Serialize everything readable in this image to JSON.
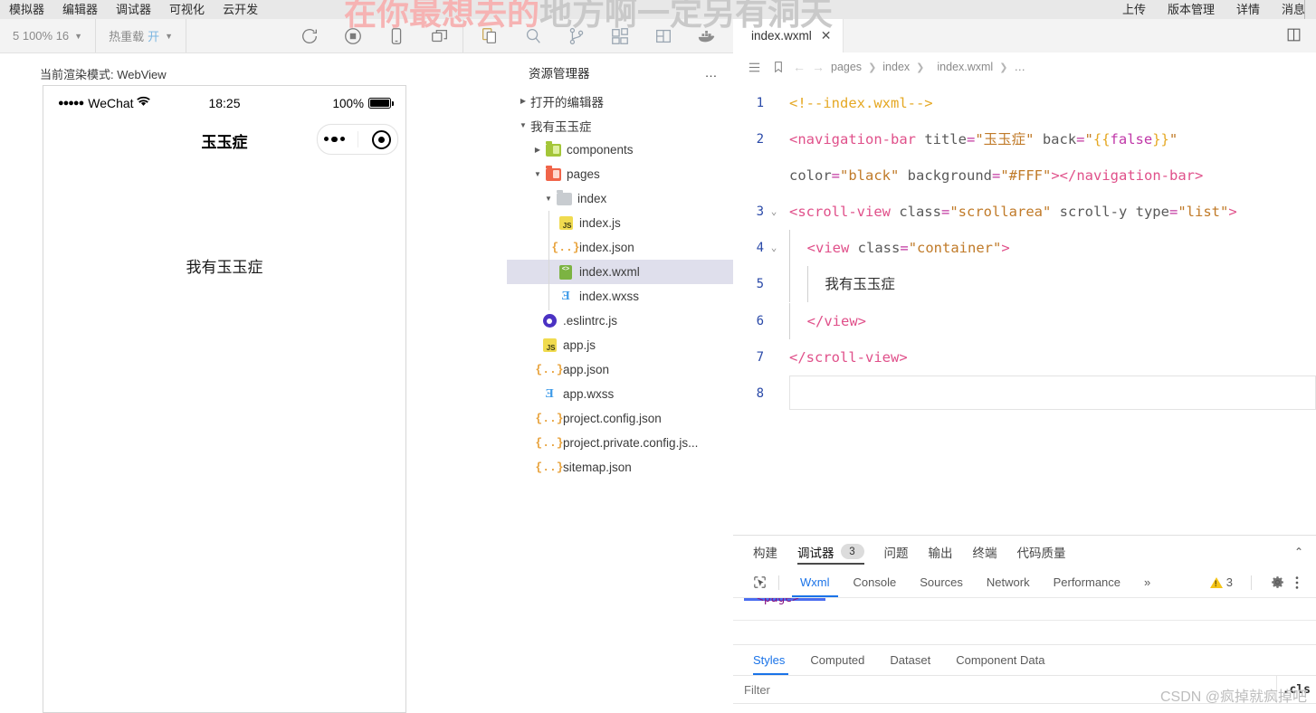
{
  "menubar": {
    "left_items": [
      "模拟器",
      "编辑器",
      "调试器",
      "可视化",
      "云开发"
    ],
    "right_items": [
      "上传",
      "版本管理",
      "详情",
      "消息"
    ]
  },
  "watermark": {
    "text_front": "在你最想去的",
    "text_back": "地方啊一定另有洞天"
  },
  "toolbar": {
    "zoom_label": "5 100% 16",
    "hot_reload_label": "热重载",
    "hot_reload_state": "开",
    "icons": [
      "refresh-icon",
      "stop-record-icon",
      "mobile-preview-icon",
      "multi-window-icon",
      "explorer-icon",
      "search-icon",
      "source-control-icon",
      "extensions-icon",
      "layout-icon",
      "docker-icon"
    ]
  },
  "simulator": {
    "render_mode_label": "当前渲染模式: WebView",
    "status_bar": {
      "signal_dots": "●●●●●",
      "carrier": "WeChat",
      "time": "18:25",
      "battery_percent": "100%"
    },
    "nav_title": "玉玉症",
    "page_text": "我有玉玉症"
  },
  "explorer": {
    "title": "资源管理器",
    "more_label": "…",
    "sections": [
      {
        "label": "打开的编辑器",
        "expanded": false
      },
      {
        "label": "我有玉玉症",
        "expanded": true
      }
    ],
    "tree": [
      {
        "label": "components",
        "icon": "folder-green-icon",
        "depth": 1,
        "type": "folder",
        "expanded": false
      },
      {
        "label": "pages",
        "icon": "folder-red-icon",
        "depth": 1,
        "type": "folder",
        "expanded": true
      },
      {
        "label": "index",
        "icon": "folder-grey-icon",
        "depth": 2,
        "type": "folder",
        "expanded": true
      },
      {
        "label": "index.js",
        "icon": "js-file-icon",
        "depth": 3,
        "type": "file",
        "selected": false
      },
      {
        "label": "index.json",
        "icon": "json-file-icon",
        "depth": 3,
        "type": "file",
        "selected": false
      },
      {
        "label": "index.wxml",
        "icon": "wxml-file-icon",
        "depth": 3,
        "type": "file",
        "selected": true
      },
      {
        "label": "index.wxss",
        "icon": "wxss-file-icon",
        "depth": 3,
        "type": "file",
        "selected": false
      },
      {
        "label": ".eslintrc.js",
        "icon": "eslint-file-icon",
        "depth": 1,
        "type": "file",
        "selected": false
      },
      {
        "label": "app.js",
        "icon": "js-file-icon",
        "depth": 1,
        "type": "file",
        "selected": false
      },
      {
        "label": "app.json",
        "icon": "json-file-icon",
        "depth": 1,
        "type": "file",
        "selected": false
      },
      {
        "label": "app.wxss",
        "icon": "wxss-file-icon",
        "depth": 1,
        "type": "file",
        "selected": false
      },
      {
        "label": "project.config.json",
        "icon": "json-file-icon",
        "depth": 1,
        "type": "file",
        "selected": false
      },
      {
        "label": "project.private.config.js...",
        "icon": "json-file-icon",
        "depth": 1,
        "type": "file",
        "selected": false
      },
      {
        "label": "sitemap.json",
        "icon": "json-file-icon",
        "depth": 1,
        "type": "file",
        "selected": false
      }
    ]
  },
  "editor": {
    "tab_label": "index.wxml",
    "tab_close": "✕",
    "breadcrumb": [
      "pages",
      "index",
      "index.wxml",
      "…"
    ],
    "split_icon": "split-editor-icon",
    "lines": [
      {
        "num": "1",
        "fold": ""
      },
      {
        "num": "2",
        "fold": ""
      },
      {
        "num": "3",
        "fold": "⌄"
      },
      {
        "num": "4",
        "fold": "⌄"
      },
      {
        "num": "5",
        "fold": ""
      },
      {
        "num": "6",
        "fold": ""
      },
      {
        "num": "7",
        "fold": ""
      },
      {
        "num": "8",
        "fold": ""
      }
    ],
    "code": {
      "l1_comment": "<!--index.wxml-->",
      "l2_tag_open": "<navigation-bar",
      "l2_attr_title": " title",
      "l2_eq": "=",
      "l2_val_title": "\"玉玉症\"",
      "l2_attr_back": " back",
      "l2_val_back_q1": "\"",
      "l2_val_back_brace_open": "{{",
      "l2_val_back_false": "false",
      "l2_val_back_brace_close": "}}",
      "l2_val_back_q2": "\"",
      "l2b_attr_color": "color",
      "l2b_val_color": "\"black\"",
      "l2b_attr_bg": " background",
      "l2b_val_bg": "\"#FFF\"",
      "l2b_close": "></navigation-bar>",
      "l3_tag": "<scroll-view",
      "l3_attr_class": " class",
      "l3_val_class": "\"scrollarea\"",
      "l3_attr_scrolly": " scroll-y",
      "l3_attr_type": " type",
      "l3_val_type": "\"list\"",
      "l3_gt": ">",
      "l4_tag": "<view",
      "l4_attr_class": " class",
      "l4_val_class": "\"container\"",
      "l4_gt": ">",
      "l5_text": "我有玉玉症",
      "l6_tag": "</view>",
      "l7_tag": "</scroll-view>"
    }
  },
  "devpanel": {
    "primary_tabs": [
      {
        "label": "构建",
        "active": false,
        "badge": ""
      },
      {
        "label": "调试器",
        "active": true,
        "badge": "3"
      },
      {
        "label": "问题",
        "active": false,
        "badge": ""
      },
      {
        "label": "输出",
        "active": false,
        "badge": ""
      },
      {
        "label": "终端",
        "active": false,
        "badge": ""
      },
      {
        "label": "代码质量",
        "active": false,
        "badge": ""
      }
    ],
    "collapse_icon": "chevron-up-icon",
    "devtools_tabs": [
      {
        "label": "Wxml",
        "active": true
      },
      {
        "label": "Console",
        "active": false
      },
      {
        "label": "Sources",
        "active": false
      },
      {
        "label": "Network",
        "active": false
      },
      {
        "label": "Performance",
        "active": false
      }
    ],
    "overflow_label": "»",
    "warning_count": "3",
    "settings_icon": "gear-icon",
    "kebab_icon": "more-vertical-icon",
    "dom_fragment": "<page>",
    "styles_tabs": [
      {
        "label": "Styles",
        "active": true
      },
      {
        "label": "Computed",
        "active": false
      },
      {
        "label": "Dataset",
        "active": false
      },
      {
        "label": "Component Data",
        "active": false
      }
    ],
    "filter_placeholder": "Filter",
    "cls_label": ".cls"
  },
  "csdn_watermark": "CSDN @疯掉就疯掉吧",
  "colors": {
    "accent_blue": "#1a73e8",
    "selection": "#dfdfec",
    "tag_pink": "#e0508a",
    "string_orange": "#c07a28",
    "comment_green": "#3aa03a"
  }
}
